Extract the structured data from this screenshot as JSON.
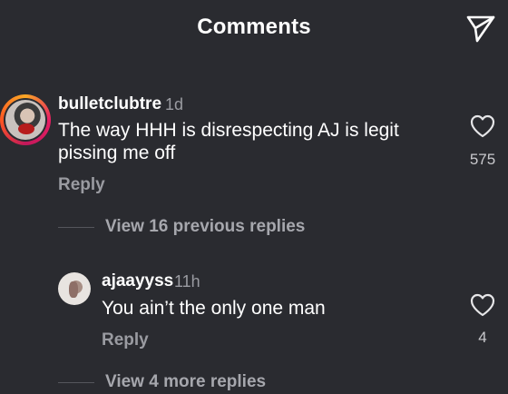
{
  "header": {
    "title": "Comments",
    "share_icon": "send-icon"
  },
  "comments": [
    {
      "username": "bulletclubtre",
      "time": "1d",
      "text_line1": "The way HHH is disrespecting AJ is legit",
      "text_line2": "pissing me off",
      "reply_label": "Reply",
      "likes": "575",
      "like_icon": "heart-outline-icon",
      "avatar_ring_colors": [
        "#f9a825",
        "#e91e63",
        "#c2185b",
        "#ff5722"
      ]
    }
  ],
  "view_previous": "View 16 previous replies",
  "replies": [
    {
      "username": "ajaayyss",
      "time": "11h",
      "text": "You ain’t the only one man",
      "reply_label": "Reply",
      "likes": "4",
      "like_icon": "heart-outline-icon"
    }
  ],
  "view_more": "View 4 more replies",
  "colors": {
    "background": "#2a2b30",
    "text_primary": "#ffffff",
    "text_secondary": "#9a9ba1"
  }
}
